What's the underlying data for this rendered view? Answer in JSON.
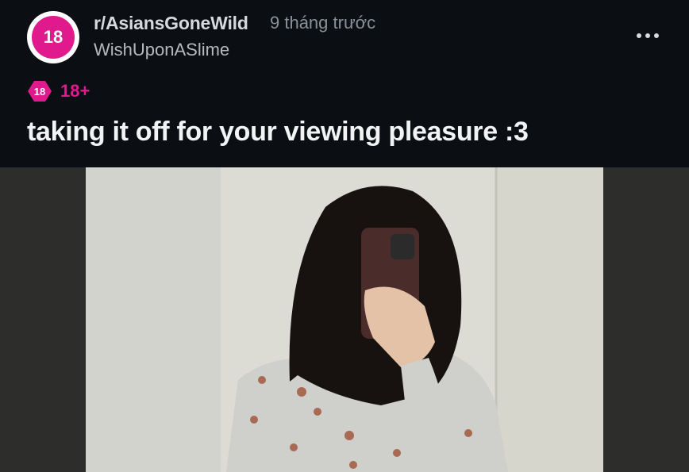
{
  "post": {
    "subreddit_avatar_text": "18",
    "subreddit": "r/AsiansGoneWild",
    "time": "9 tháng trước",
    "author": "WishUponASlime",
    "nsfw_icon_text": "18",
    "nsfw_label": "18+",
    "title": "taking it off for your viewing pleasure :3"
  },
  "icons": {
    "more": "more-horizontal-icon",
    "nsfw": "nsfw-diamond-icon"
  },
  "colors": {
    "background": "#0b0e13",
    "nsfw_accent": "#e01a8c",
    "secondary_text": "#8c9196"
  }
}
